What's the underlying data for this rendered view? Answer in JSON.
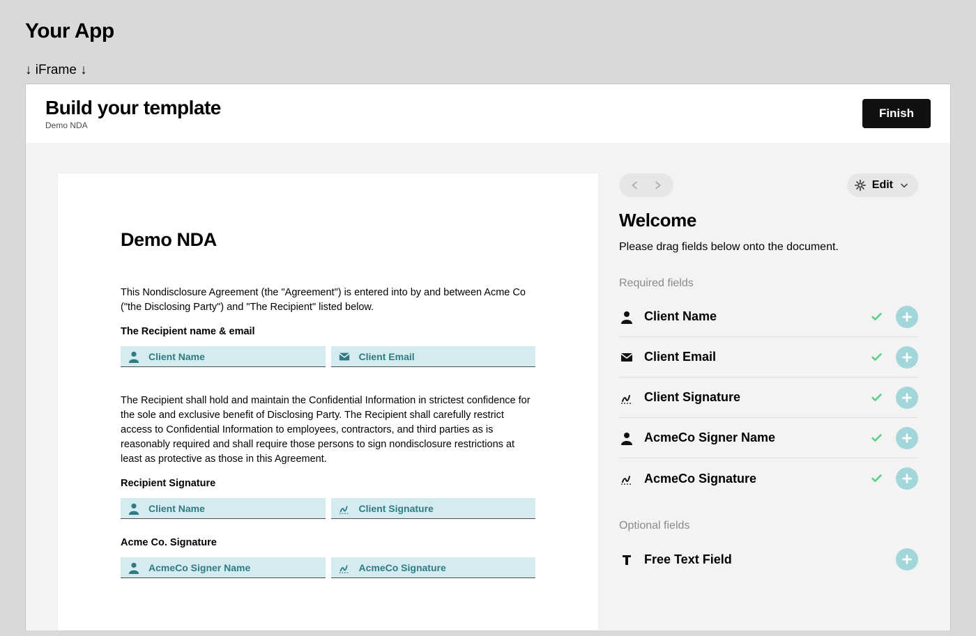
{
  "app_title": "Your App",
  "iframe_label": "↓ iFrame ↓",
  "header": {
    "title": "Build your template",
    "subtitle": "Demo NDA",
    "finish": "Finish"
  },
  "document": {
    "title": "Demo NDA",
    "intro": "This Nondisclosure Agreement (the \"Agreement\") is entered into by and between Acme Co (\"the Disclosing Party\") and \"The Recipient\" listed below.",
    "recipient_label": "The Recipient name & email",
    "recipient_name": "Client Name",
    "recipient_email": "Client Email",
    "body": "The Recipient shall hold and maintain the Confidential Information in strictest confidence for the sole and exclusive benefit of Disclosing Party. The Recipient shall carefully restrict access to Confidential Information to employees, contractors, and third parties as is reasonably required and shall require those persons to sign nondisclosure restrictions at least as protective as those in this Agreement.",
    "recipient_sig_label": "Recipient Signature",
    "recipient_sig_name": "Client Name",
    "recipient_sig_field": "Client Signature",
    "acme_label": "Acme Co. Signature",
    "acme_name": "AcmeCo Signer Name",
    "acme_sig": "AcmeCo Signature"
  },
  "sidebar": {
    "edit_label": "Edit",
    "welcome": "Welcome",
    "instruction": "Please drag fields below onto the document.",
    "required_label": "Required fields",
    "optional_label": "Optional fields",
    "required": [
      {
        "icon": "person",
        "label": "Client Name"
      },
      {
        "icon": "mail",
        "label": "Client Email"
      },
      {
        "icon": "signature",
        "label": "Client Signature"
      },
      {
        "icon": "person",
        "label": "AcmeCo Signer Name"
      },
      {
        "icon": "signature",
        "label": "AcmeCo Signature"
      }
    ],
    "optional": [
      {
        "icon": "text",
        "label": "Free Text Field"
      }
    ]
  }
}
